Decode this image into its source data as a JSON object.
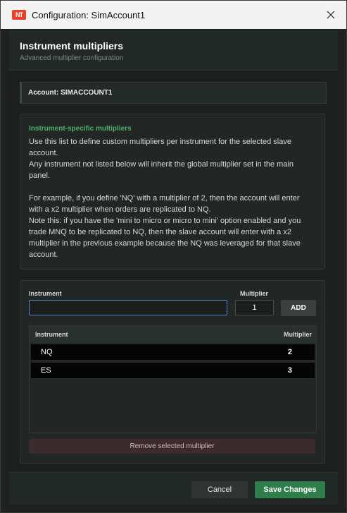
{
  "window": {
    "title": "Configuration: SimAccount1",
    "logo_text": "NT"
  },
  "header": {
    "title": "Instrument multipliers",
    "subtitle": "Advanced multiplier configuration"
  },
  "account": {
    "label": "Account: SIMACCOUNT1"
  },
  "info": {
    "title": "Instrument-specific multipliers",
    "paragraphs": [
      "Use this list to define custom multipliers per instrument for the selected slave account.",
      "Any instrument not listed below will inherit the global multiplier set in the main panel.",
      "For example, if you define 'NQ' with a multiplier of 2, then the account will enter with a x2 multiplier when orders are replicated to NQ.",
      "Note this: if you have the 'mini to micro or micro to mini' option enabled and you trade MNQ to be replicated to NQ, then the slave account will enter with a x2 multiplier in the previous example because the NQ was leveraged for that slave account."
    ]
  },
  "form": {
    "instrument_label": "Instrument",
    "instrument_value": "",
    "multiplier_label": "Multiplier",
    "multiplier_value": "1",
    "add_label": "ADD"
  },
  "table": {
    "columns": [
      "Instrument",
      "Multiplier"
    ],
    "rows": [
      {
        "instrument": "NQ",
        "multiplier": "2"
      },
      {
        "instrument": "ES",
        "multiplier": "3"
      }
    ]
  },
  "remove_label": "Remove selected multiplier",
  "footer": {
    "cancel_label": "Cancel",
    "save_label": "Save Changes"
  },
  "colors": {
    "accent": "#2e7d4a",
    "info_title": "#4caf6c",
    "input_focus": "#4a86c8",
    "danger_bg": "#3b2b2c"
  }
}
